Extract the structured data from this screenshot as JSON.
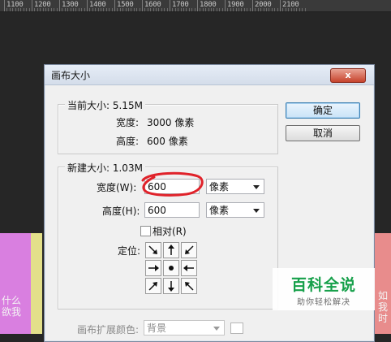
{
  "ruler": {
    "marks": [
      "1100",
      "1200",
      "1300",
      "1400",
      "1500",
      "1600",
      "1700",
      "1800",
      "1900",
      "2000",
      "2100"
    ]
  },
  "canvas": {
    "strips": [
      {
        "color": "#d97fe0"
      },
      {
        "color": "#e3e08a"
      },
      {
        "color": "#a8d9a4"
      },
      {
        "color": "#e88c8c"
      }
    ],
    "left_text": "什么\n欲我",
    "right_text": "如\n我\n时"
  },
  "dialog": {
    "title": "画布大小",
    "close_label": "x",
    "current": {
      "heading": "当前大小: 5.15M",
      "width_label": "宽度:",
      "width_value": "3000 像素",
      "height_label": "高度:",
      "height_value": "600 像素"
    },
    "new": {
      "heading": "新建大小: 1.03M",
      "width_label": "宽度(W):",
      "width_value": "600",
      "width_unit": "像素",
      "height_label": "高度(H):",
      "height_value": "600",
      "height_unit": "像素",
      "relative_label": "相对(R)",
      "anchor_label": "定位:"
    },
    "ok_label": "确定",
    "cancel_label": "取消",
    "extension_color_label": "画布扩展颜色:",
    "extension_color_value": "背景"
  },
  "annotation": {
    "color": "#e0222a"
  },
  "watermark": {
    "title": "百科全说",
    "subtitle": "助你轻松解决"
  }
}
